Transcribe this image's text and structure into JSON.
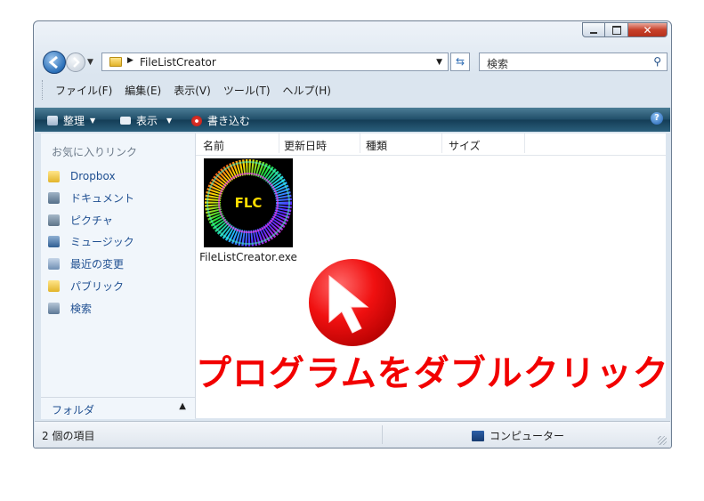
{
  "window": {
    "address": "FileListCreator",
    "search_placeholder": "検索"
  },
  "menu": [
    "ファイル(F)",
    "編集(E)",
    "表示(V)",
    "ツール(T)",
    "ヘルプ(H)"
  ],
  "toolbar": {
    "organize": "整理",
    "view": "表示",
    "burn": "書き込む"
  },
  "sidebar": {
    "title": "お気に入りリンク",
    "items": [
      {
        "label": "Dropbox",
        "icon": "dropbox-folder-icon"
      },
      {
        "label": "ドキュメント",
        "icon": "documents-icon"
      },
      {
        "label": "ピクチャ",
        "icon": "pictures-icon"
      },
      {
        "label": "ミュージック",
        "icon": "music-icon"
      },
      {
        "label": "最近の変更",
        "icon": "recent-icon"
      },
      {
        "label": "パブリック",
        "icon": "public-folder-icon"
      },
      {
        "label": "検索",
        "icon": "search-folder-icon"
      }
    ],
    "folders_label": "フォルダ"
  },
  "columns": [
    "名前",
    "更新日時",
    "種類",
    "サイズ"
  ],
  "file": {
    "name": "FileListCreator.exe",
    "icon_text": "FLC"
  },
  "status": {
    "left": "2 個の項目",
    "right": "コンピューター"
  },
  "overlay": {
    "caption": "プログラムをダブルクリック"
  },
  "colors": {
    "overlay_red": "#f20000",
    "toolbar": "#1f4d68",
    "link": "#1f4f91"
  }
}
